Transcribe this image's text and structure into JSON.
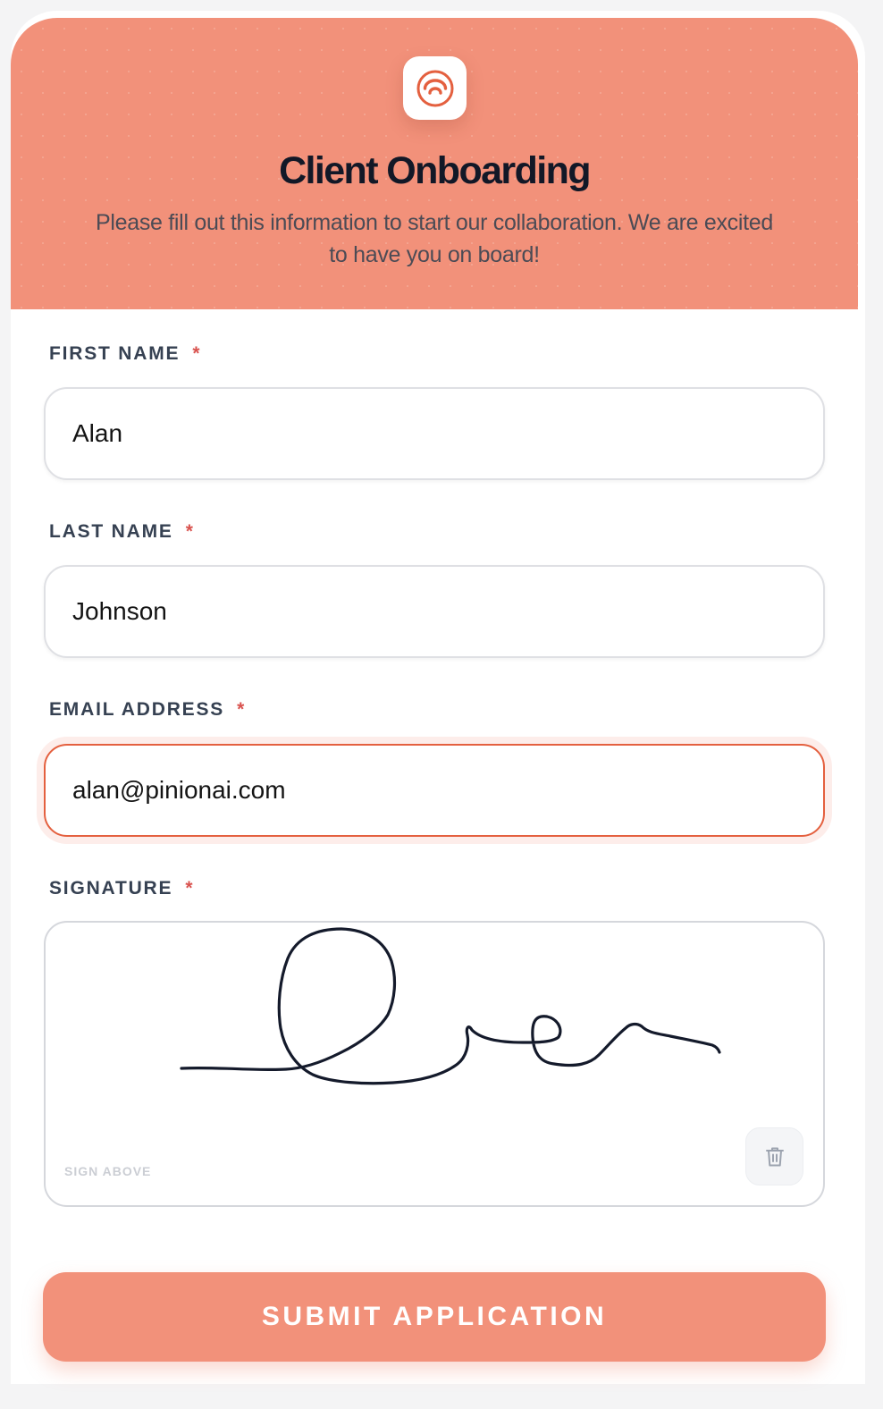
{
  "form": {
    "logo_icon": "orange-arc-logo-icon",
    "title": "Client Onboarding",
    "subtitle": "Please fill out this information to start our collaboration. We are excited to have you on board!",
    "accent_color": "#f2917a",
    "focus_color": "#e4603f"
  },
  "fields": {
    "first_name": {
      "label": "FIRST NAME",
      "required_mark": "*",
      "value": "Alan"
    },
    "last_name": {
      "label": "LAST NAME",
      "required_mark": "*",
      "value": "Johnson"
    },
    "email": {
      "label": "EMAIL ADDRESS",
      "required_mark": "*",
      "value": "alan@pinionai.com"
    },
    "signature": {
      "label": "SIGNATURE",
      "required_mark": "*",
      "hint": "SIGN ABOVE",
      "clear_icon": "trash-icon"
    }
  },
  "submit": {
    "label": "SUBMIT APPLICATION"
  }
}
